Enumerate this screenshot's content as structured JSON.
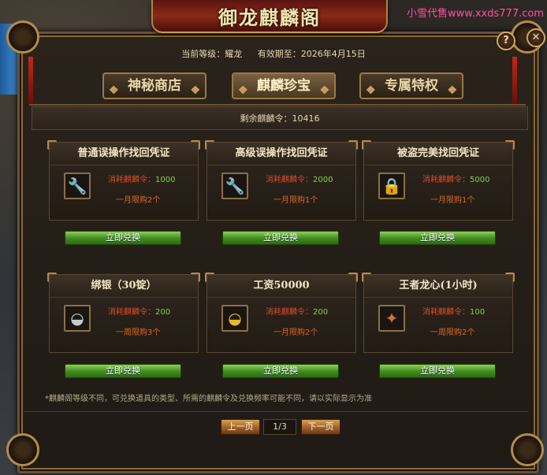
{
  "watermark": "小雪代售www.xxds777.com",
  "window_title": "御龙麒麟阁",
  "header": {
    "level_label": "当前等级：耀龙",
    "expiry_label": "有效期至：2026年4月15日"
  },
  "buttons": {
    "help": "?",
    "close": "✕"
  },
  "tabs": [
    {
      "label": "神秘商店",
      "active": false
    },
    {
      "label": "麒麟珍宝",
      "active": true
    },
    {
      "label": "专属特权",
      "active": false
    }
  ],
  "remaining": "剩余麒麟令：10416",
  "items": [
    {
      "title": "普通误操作找回凭证",
      "icon": "wrench-icon",
      "cost_label": "消耗麒麟令：",
      "cost": "1000",
      "limit": "一月限购2个",
      "button": "立即兑换"
    },
    {
      "title": "高级误操作找回凭证",
      "icon": "wrench-icon",
      "cost_label": "消耗麒麟令：",
      "cost": "2000",
      "limit": "一月限购1个",
      "button": "立即兑换"
    },
    {
      "title": "被盗完美找回凭证",
      "icon": "lock-chest-icon",
      "cost_label": "消耗麒麟令：",
      "cost": "5000",
      "limit": "一月限购1个",
      "button": "立即兑换"
    },
    {
      "title": "绑银（30锭）",
      "icon": "silver-ingot-icon",
      "cost_label": "消耗麒麟令：",
      "cost": "200",
      "limit": "一周限购3个",
      "button": "立即兑换"
    },
    {
      "title": "工资50000",
      "icon": "gold-ingot-icon",
      "cost_label": "消耗麒麟令：",
      "cost": "200",
      "limit": "一月限购2个",
      "button": "立即兑换"
    },
    {
      "title": "王者龙心(1小时)",
      "icon": "dragon-heart-icon",
      "cost_label": "消耗麒麟令：",
      "cost": "100",
      "limit": "一周限购2个",
      "button": "立即兑换"
    }
  ],
  "notice": "*麒麟阁等级不同，可兑换道具的类型、所需的麒麟令及兑换频率可能不同，请以实际显示为准",
  "pager": {
    "prev": "上一页",
    "page": "1/3",
    "next": "下一页"
  },
  "colors": {
    "cost_value": "#7fd448",
    "cost_label": "#d84a2a",
    "button_green": "#3f8a1e",
    "frame_gold": "#b58b4a"
  }
}
